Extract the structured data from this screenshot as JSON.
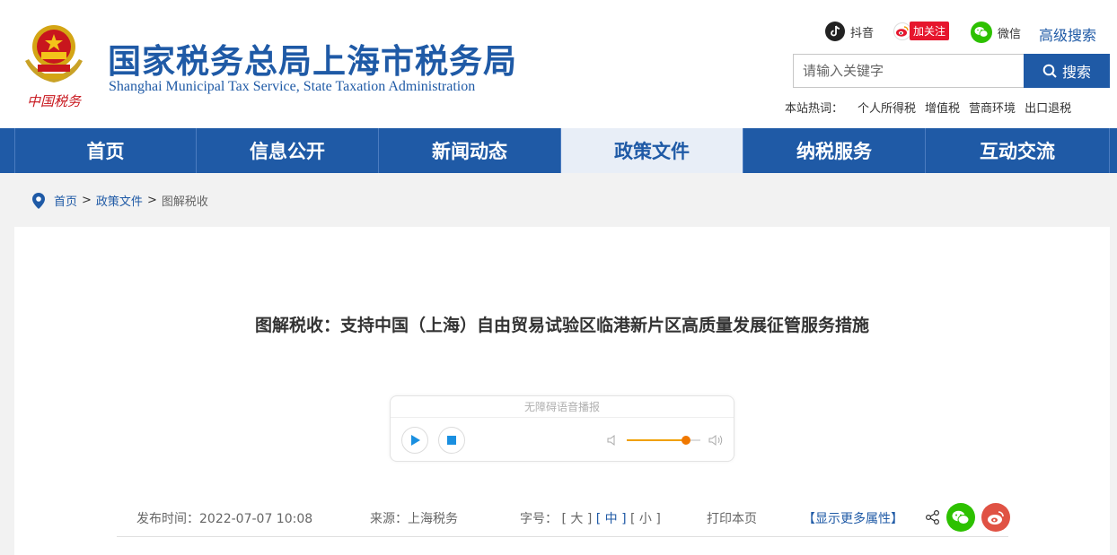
{
  "header": {
    "title_cn": "国家税务总局上海市税务局",
    "title_en": "Shanghai Municipal Tax Service, State Taxation Administration",
    "emblem_text": "中国税务",
    "social": {
      "douyin": "抖音",
      "weibo_follow": "加关注",
      "wechat": "微信"
    },
    "advanced_search": "高级搜索",
    "search": {
      "placeholder": "请输入关键字",
      "button": "搜索"
    },
    "hotwords": {
      "label": "本站热词：",
      "items": [
        "个人所得税",
        "增值税",
        "营商环境",
        "出口退税"
      ]
    }
  },
  "nav": {
    "items": [
      "首页",
      "信息公开",
      "新闻动态",
      "政策文件",
      "纳税服务",
      "互动交流"
    ],
    "active": "政策文件"
  },
  "breadcrumb": {
    "home": "首页",
    "sep": ">",
    "level1": "政策文件",
    "current": "图解税收"
  },
  "article": {
    "title": "图解税收：支持中国（上海）自由贸易试验区临港新片区高质量发展征管服务措施",
    "player": {
      "title": "无障碍语音播报",
      "volume": 0.8
    },
    "meta": {
      "date": "发布时间：2022-07-07 10:08",
      "source": "来源：上海税务",
      "font_label": "字号：",
      "font_large": "[ 大 ]",
      "font_medium": "[ 中 ]",
      "font_small": "[ 小 ]",
      "print": "打印本页",
      "more": "【显示更多属性】"
    }
  },
  "colors": {
    "brand_blue": "#1f5aa6",
    "nav_active_bg": "#e8eef7",
    "wechat_green": "#2dc100",
    "weibo_red": "#e05244",
    "volume_orange": "#f07800"
  }
}
